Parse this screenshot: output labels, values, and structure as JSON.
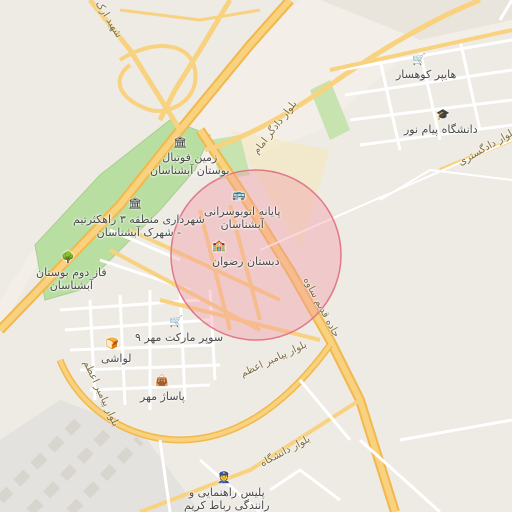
{
  "map": {
    "pois": [
      {
        "id": "hyper",
        "label": "هایپر کوهسار",
        "icon": "shopping-cart-icon"
      },
      {
        "id": "payam",
        "label": "دانشگاه پیام نور",
        "icon": "university-icon"
      },
      {
        "id": "football",
        "label_line1": "زمین فوتبال",
        "label_line2": "بوستان آبشناسان",
        "icon": "stadium-icon"
      },
      {
        "id": "terminal",
        "label_line1": "پایانه اتوبوسرانی",
        "label_line2": "آبشناسان",
        "icon": "bus-icon"
      },
      {
        "id": "municipality",
        "label_line1": "شهرداری منطقه ۳ راهکثرتیم",
        "label_line2": "- شهرک آبشناسان",
        "icon": "government-building-icon"
      },
      {
        "id": "school",
        "label": "دبستان رضوان",
        "icon": "school-icon"
      },
      {
        "id": "park2",
        "label_line1": "فاز دوم بوستان",
        "label_line2": "آبشناسان",
        "icon": "tree-icon"
      },
      {
        "id": "supermarket",
        "label": "سوپر مارکت مهر ۹",
        "icon": "shopping-cart-icon"
      },
      {
        "id": "lavashi",
        "label": "لواشی",
        "icon": "bakery-icon"
      },
      {
        "id": "pasaj",
        "label": "پاساژ مهر",
        "icon": "shopping-bag-icon"
      },
      {
        "id": "police",
        "label_line1": "پلیس راهنمایی و",
        "label_line2": "رانندگی رباط کریم",
        "icon": "police-icon"
      }
    ],
    "roads": {
      "shahid": "شهید ارک",
      "dadgar": "بلوار دادگر امام",
      "khodakar": "بلوار دادگستری",
      "ghadir": "جاده قدیم ساوه",
      "azam_a": "بلوار پیامبر اعظم",
      "azam_b": "بلوار پیامبر اعظم",
      "daneshgah": "بلوار دانشگاه"
    },
    "colors": {
      "background": "#eeeae4",
      "road": "#ffffff",
      "major_road": "#f7d77e",
      "highway": "#f2b84b",
      "park": "#b9dea1",
      "circle_fill": "#f29aa5",
      "circle_stroke": "#e27888"
    }
  }
}
